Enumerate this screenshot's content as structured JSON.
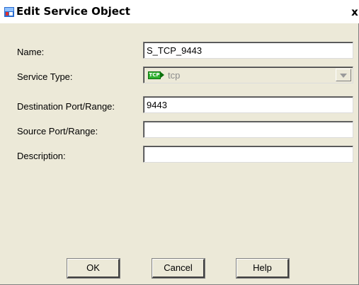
{
  "window": {
    "title": "Edit Service Object",
    "close_glyph": "x",
    "app_icon": "asdm-icon"
  },
  "form": {
    "name_label": "Name:",
    "name_value": "S_TCP_9443",
    "service_type_label": "Service Type:",
    "service_type_badge": "TCP",
    "service_type_value": "tcp",
    "dest_port_label": "Destination Port/Range:",
    "dest_port_value": "9443",
    "source_port_label": "Source Port/Range:",
    "source_port_value": "",
    "description_label": "Description:",
    "description_value": ""
  },
  "buttons": {
    "ok": "OK",
    "cancel": "Cancel",
    "help": "Help"
  }
}
